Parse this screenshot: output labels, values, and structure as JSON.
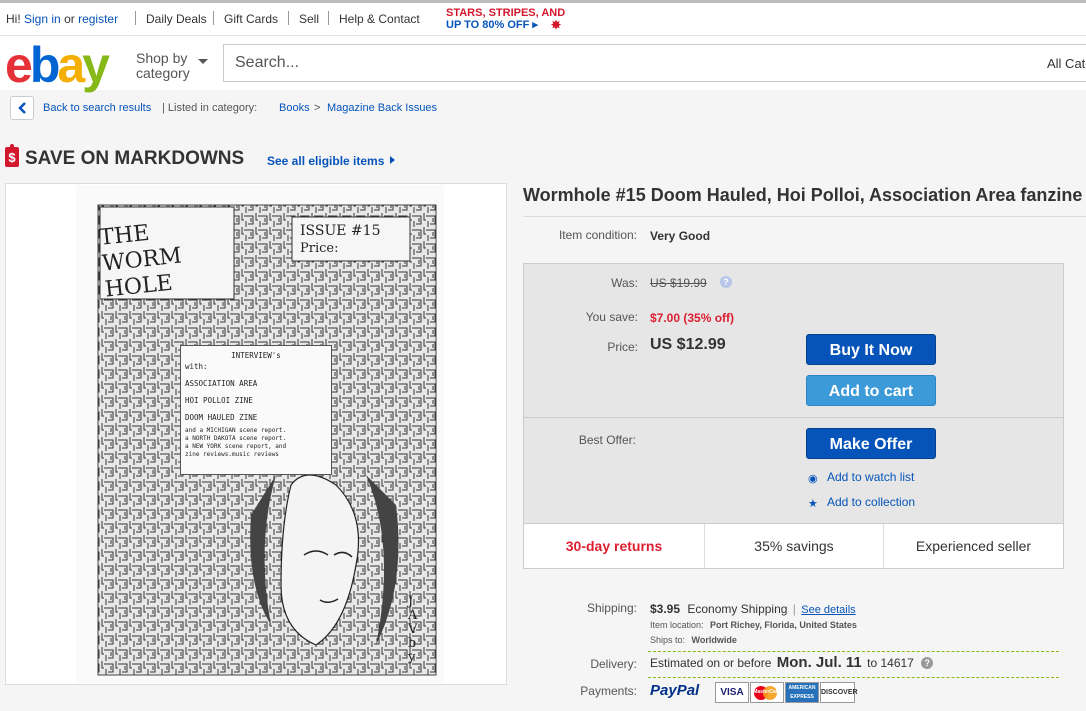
{
  "topbar": {
    "greeting": "Hi!",
    "signin": "Sign in",
    "or": "or",
    "register": "register",
    "links": [
      "Daily Deals",
      "Gift Cards",
      "Sell",
      "Help & Contact"
    ],
    "promo_line1": "STARS, STRIPES, AND",
    "promo_line2": "UP TO 80% OFF",
    "promo_arrow": "▸"
  },
  "header": {
    "logo": [
      "e",
      "b",
      "a",
      "y"
    ],
    "shop_by_line1": "Shop by",
    "shop_by_line2": "category",
    "search_placeholder": "Search...",
    "all_categories": "All Categories"
  },
  "breadcrumb": {
    "back": "Back to search results",
    "listed_in": "| Listed in category:",
    "cat1": "Books",
    "arrow": ">",
    "cat2": "Magazine Back Issues"
  },
  "markdown": {
    "icon": "$",
    "title": "SAVE ON MARKDOWNS",
    "link": "See all eligible items"
  },
  "cover": {
    "title_hand": "THE WORM HOLE",
    "issue": "ISSUE #15",
    "price": "Price:",
    "label_lines": [
      "INTERVIEW's",
      "with:",
      "ASSOCIATION AREA",
      "HOI POLLOI ZINE",
      "DOOM HAULED ZINE",
      "and a MICHIGAN scene report.",
      "a NORTH DAKOTA scene report.",
      "a NEW YORK scene report, and",
      "zine reviews.music reviews"
    ],
    "signature": "JAV by"
  },
  "item": {
    "title": "Wormhole #15 Doom Hauled, Hoi Polloi, Association Area fanzine",
    "condition_label": "Item condition:",
    "condition": "Very Good",
    "was_label": "Was:",
    "was": "US $19.99",
    "save_label": "You save:",
    "save": "$7.00 (35% off)",
    "price_label": "Price:",
    "price": "US $12.99",
    "buy_now": "Buy It Now",
    "add_to_cart": "Add to cart",
    "best_offer_label": "Best Offer:",
    "make_offer": "Make Offer",
    "watch": "Add to watch list",
    "collection": "Add to collection",
    "strip": [
      "30-day returns",
      "35% savings",
      "Experienced seller"
    ],
    "strip_accent": "#dd1e31"
  },
  "shipping": {
    "label": "Shipping:",
    "cost": "$3.95",
    "method": "Economy Shipping",
    "details": "See details",
    "location_label": "Item location:",
    "location": "Port Richey, Florida, United States",
    "ships_to_label": "Ships to:",
    "ships_to": "Worldwide",
    "delivery_label": "Delivery:",
    "delivery_pre": "Estimated on or before",
    "delivery_date": "Mon. Jul. 11",
    "delivery_to": "to 14617",
    "payments_label": "Payments:",
    "paypal": "PayPal",
    "cards": [
      "VISA",
      "MasterCard",
      "AMERICAN EXPRESS",
      "DISCOVER"
    ]
  }
}
